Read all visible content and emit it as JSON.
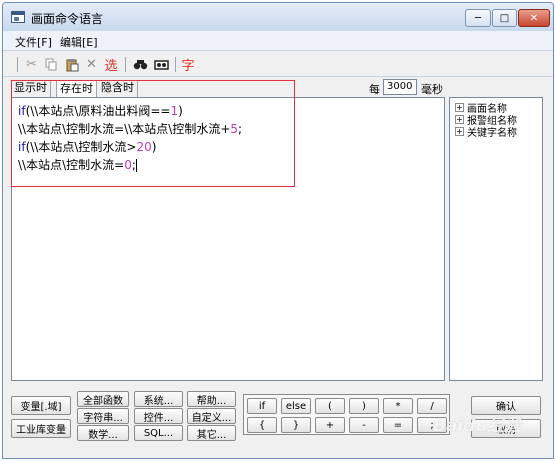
{
  "window": {
    "title": "画面命令语言"
  },
  "menu": [
    {
      "label": "文件[F]"
    },
    {
      "label": "编辑[E]"
    }
  ],
  "toolbar": {
    "select_label": "选",
    "char_label": "字",
    "colors": {
      "select": "#e0322a",
      "char": "#e0322a"
    }
  },
  "tabs": [
    {
      "label": "显示时",
      "active": false
    },
    {
      "label": "存在时",
      "active": true
    },
    {
      "label": "隐含时",
      "active": false
    }
  ],
  "interval": {
    "prefix": "每",
    "value": "3000",
    "unit": "毫秒"
  },
  "code_lines": [
    [
      {
        "t": "if",
        "c": "kw"
      },
      {
        "t": "(\\\\本站点\\原料油出料阀=="
      },
      {
        "t": "1",
        "c": "num"
      },
      {
        "t": ")"
      }
    ],
    [
      {
        "t": "\\\\本站点\\控制水流=\\\\本站点\\控制水流+"
      },
      {
        "t": "5",
        "c": "num"
      },
      {
        "t": ";"
      }
    ],
    [
      {
        "t": "if",
        "c": "kw"
      },
      {
        "t": "(\\\\本站点\\控制水流>"
      },
      {
        "t": "20",
        "c": "num"
      },
      {
        "t": ")"
      }
    ],
    [
      {
        "t": "\\\\本站点\\控制水流="
      },
      {
        "t": "0",
        "c": "num"
      },
      {
        "t": ";"
      }
    ]
  ],
  "tree": [
    {
      "label": "画面名称",
      "expander": "+"
    },
    {
      "label": "报警组名称",
      "expander": "+"
    },
    {
      "label": "关键字名称",
      "expander": "+"
    }
  ],
  "buttons": {
    "variable_domain": "变量[.域]",
    "industrial_variable": "工业库变量",
    "all_functions": "全部函数",
    "system": "系统...",
    "help": "帮助...",
    "string": "字符串...",
    "control": "控件...",
    "custom": "自定义...",
    "math": "数学...",
    "sql": "SQL...",
    "other": "其它...",
    "confirm": "确认",
    "cancel": "取消"
  },
  "operators": [
    [
      "if",
      "else",
      "(",
      ")",
      "*",
      "/"
    ],
    [
      "{",
      "}",
      "+",
      "-",
      "=",
      ";"
    ]
  ],
  "watermark": "Baidu经验"
}
